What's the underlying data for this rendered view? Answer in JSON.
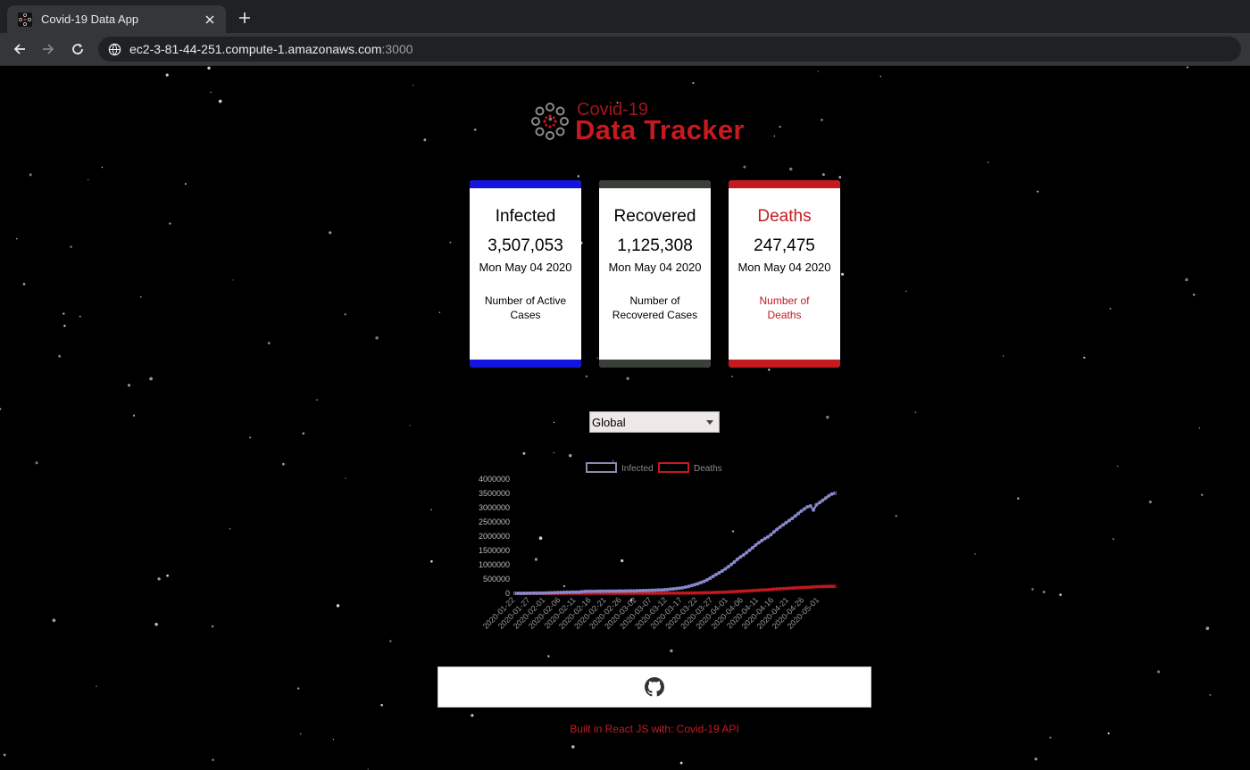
{
  "browser": {
    "tab_title": "Covid-19 Data App",
    "url_host": "ec2-3-81-44-251.compute-1.amazonaws.com",
    "url_port": ":3000"
  },
  "logo": {
    "line1": "Covid-19",
    "line2": "Data Tracker"
  },
  "cards": [
    {
      "title": "Infected",
      "value": "3,507,053",
      "date": "Mon May 04 2020",
      "description": "Number of Active Cases",
      "accent": "#1414e0"
    },
    {
      "title": "Recovered",
      "value": "1,125,308",
      "date": "Mon May 04 2020",
      "description": "Number of Recovered Cases",
      "accent": "#3a3f3a"
    },
    {
      "title": "Deaths",
      "value": "247,475",
      "date": "Mon May 04 2020",
      "description": "Number of Deaths",
      "accent": "#c41a20"
    }
  ],
  "country_select": {
    "selected": "Global"
  },
  "chart_data": {
    "type": "line",
    "series": [
      {
        "name": "Infected",
        "color": "#8a8ad0",
        "values": [
          555,
          654,
          941,
          1434,
          2118,
          2927,
          5578,
          6166,
          8234,
          9927,
          12038,
          16787,
          19881,
          23892,
          27635,
          30817,
          34391,
          37120,
          40150,
          42762,
          44802,
          45221,
          60368,
          66885,
          69030,
          71224,
          73258,
          75136,
          75639,
          76197,
          76819,
          78572,
          78958,
          79561,
          80406,
          81388,
          82746,
          84112,
          86604,
          88585,
          90443,
          93016,
          95314,
          98425,
          102050,
          106099,
          109991,
          114381,
          118948,
          126214,
          134576,
          145483,
          156653,
          169593,
          182490,
          198238,
          218822,
          244933,
          275550,
          305275,
          337553,
          378235,
          418045,
          467653,
          529591,
          593291,
          660693,
          720140,
          782389,
          857487,
          932605,
          1013466,
          1095917,
          1197405,
          1272115,
          1345101,
          1426096,
          1511104,
          1595350,
          1691719,
          1771514,
          1846679,
          1917320,
          1976192,
          2056055,
          2152437,
          2240190,
          2317759,
          2401378,
          2472259,
          2549123,
          2624000,
          2708885,
          2795731,
          2881140,
          2955033,
          3032237,
          3061882,
          2920000,
          3105000,
          3181000,
          3260000,
          3339000,
          3417000,
          3479000,
          3507053
        ]
      },
      {
        "name": "Deaths",
        "color": "#c41a20",
        "values": [
          17,
          18,
          26,
          42,
          56,
          82,
          131,
          133,
          171,
          213,
          259,
          362,
          426,
          492,
          564,
          634,
          719,
          806,
          906,
          1013,
          1113,
          1118,
          1371,
          1523,
          1666,
          1770,
          1868,
          2007,
          2122,
          2247,
          2251,
          2458,
          2469,
          2629,
          2708,
          2770,
          2814,
          2872,
          2941,
          2996,
          3085,
          3160,
          3254,
          3348,
          3460,
          3558,
          3803,
          3996,
          4262,
          4615,
          4720,
          5404,
          5819,
          6440,
          7126,
          7905,
          8733,
          9867,
          11299,
          12973,
          14651,
          16505,
          18625,
          21181,
          23970,
          27198,
          30652,
          33925,
          37582,
          42107,
          46809,
          52983,
          58787,
          64606,
          69374,
          74565,
          81865,
          88338,
          95455,
          102525,
          108503,
          114091,
          119482,
          125984,
          134177,
          143800,
          153821,
          159509,
          165044,
          169986,
          176583,
          183027,
          190858,
          197159,
          202846,
          206544,
          211167,
          217153,
          224172,
          229971,
          234108,
          237627,
          241000,
          244000,
          246000,
          247475
        ]
      }
    ],
    "x_ticks": [
      "2020-01-22",
      "2020-01-27",
      "2020-02-01",
      "2020-02-06",
      "2020-02-11",
      "2020-02-16",
      "2020-02-21",
      "2020-02-26",
      "2020-03-02",
      "2020-03-07",
      "2020-03-12",
      "2020-03-17",
      "2020-03-22",
      "2020-03-27",
      "2020-04-01",
      "2020-04-06",
      "2020-04-11",
      "2020-04-16",
      "2020-04-21",
      "2020-04-26",
      "2020-05-01"
    ],
    "y_ticks": [
      "4000000",
      "3500000",
      "3000000",
      "2500000",
      "2000000",
      "1500000",
      "1000000",
      "500000",
      "0"
    ],
    "ylim": [
      0,
      4000000
    ],
    "legend_position": "top",
    "grid": false
  },
  "footer": {
    "text": "Built in React JS with: Covid-19 API"
  },
  "icons": {
    "github": "github-icon",
    "tab_favicon": "virus-icon"
  }
}
